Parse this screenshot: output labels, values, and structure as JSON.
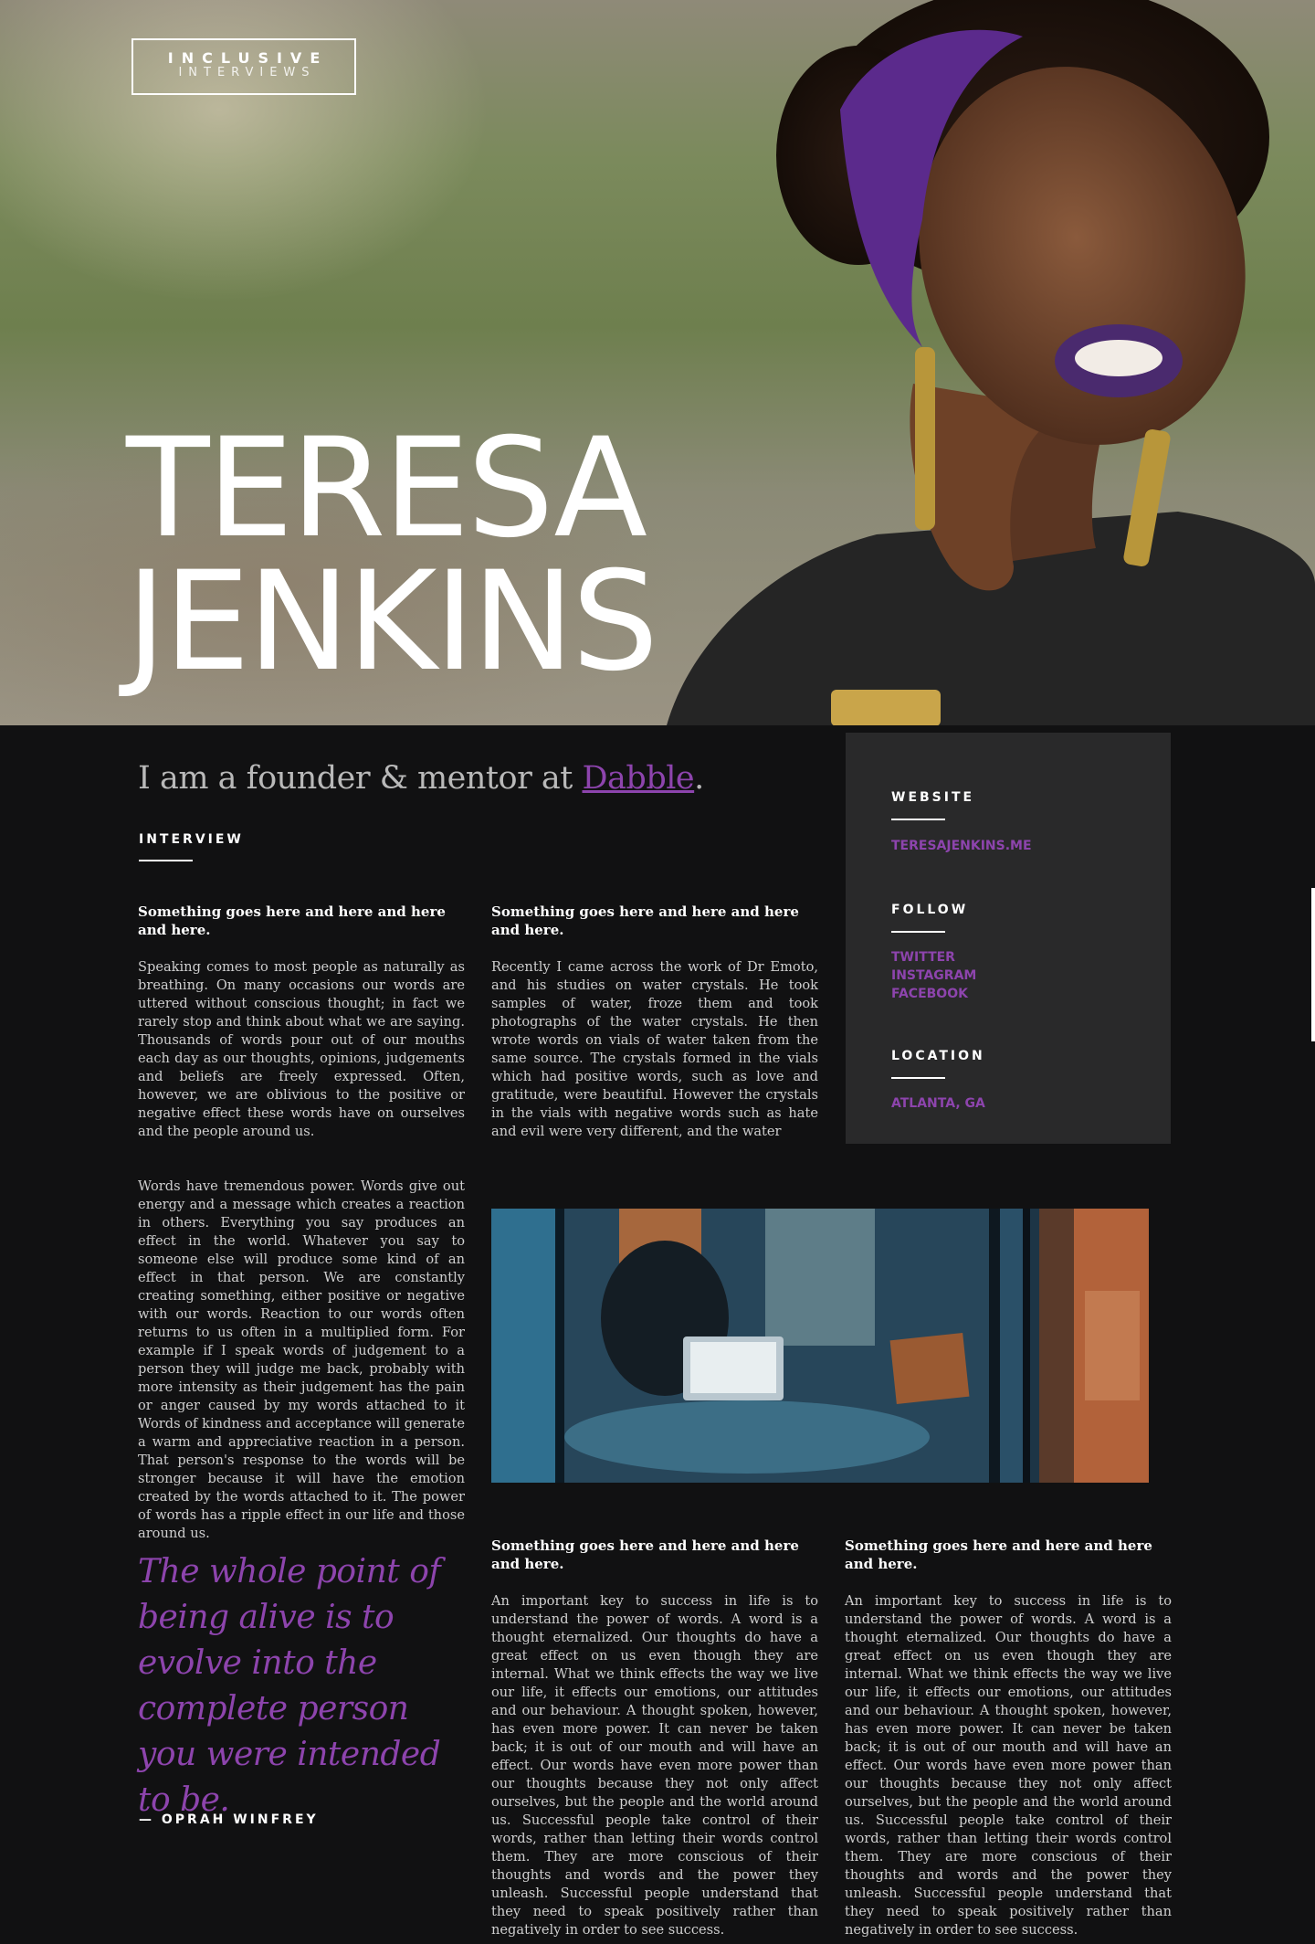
{
  "brand": {
    "line1": "INCLUSIVE",
    "line2": "INTERVIEWS"
  },
  "hero": {
    "first_name": "TERESA",
    "last_name": "JENKINS"
  },
  "intro": {
    "prefix": "I am a founder & mentor at ",
    "link": "Dabble",
    "suffix": "."
  },
  "interview_label": "INTERVIEW",
  "columns": [
    {
      "title": "Something goes here and here and here and here.",
      "text": "Speaking comes to most people as naturally as breathing. On many occasions our words are uttered without conscious thought; in fact we rarely stop and think about what we are saying. Thousands of words pour out of our mouths each day as our thoughts, opinions, judgements and beliefs are freely expressed. Often, however, we are oblivious to the positive or negative effect these words have on ourselves and the people around us."
    },
    {
      "title": "Something goes here and here and here and here.",
      "text": "Recently I came across the work of Dr Emoto, and his studies on water crystals. He took samples of water, froze them and took photographs of the water crystals. He then wrote words on vials of water taken from the same source. The crystals formed in the vials which had positive words, such as love and gratitude, were beautiful. However the crystals in the vials with negative words such as hate and evil were very different, and the water"
    },
    {
      "title": "",
      "text": "Words have tremendous power. Words give out energy and a message which creates a reaction in others. Everything you say produces an effect in the world. Whatever you say to someone else will produce some kind of an effect in that person. We are constantly creating something, either positive or negative with our words. Reaction to our words often returns to us often in a multiplied form. For example if I speak words of judgement to a person they will judge me back, probably with more intensity as their judgement has the pain or anger caused by my words attached to it Words of kindness and acceptance will generate a warm and appreciative reaction in a person. That person's response to the words will be stronger because it will have the emotion created by the words attached to it. The power of words has a ripple effect in our life and those around us."
    },
    {
      "title": "Something goes here and here and here and here.",
      "text": "An important key to success in life is to understand the power of words. A word is a thought eternalized. Our thoughts do have a great effect on us even though they are internal. What we think effects the way we live our life, it effects our emotions, our attitudes and our behaviour. A thought spoken, however, has even more power. It can never be taken back; it is out of our mouth and will have an effect. Our words have even more power than our thoughts because they not only affect ourselves, but the people and the world around us. Successful people take control of their words, rather than letting their words control them. They are more conscious of their thoughts and words and the power they unleash. Successful people understand that they need to speak positively rather than negatively in order to see success."
    },
    {
      "title": "Something goes here and here and here and here.",
      "text": "An important key to success in life is to understand the power of words. A word is a thought eternalized. Our thoughts do have a great effect on us even though they are internal. What we think effects the way we live our life, it effects our emotions, our attitudes and our behaviour. A thought spoken, however, has even more power. It can never be taken back; it is out of our mouth and will have an effect. Our words have even more power than our thoughts because they not only affect ourselves, but the people and the world around us. Successful people take control of their words, rather than letting their words control them. They are more conscious of their thoughts and words and the power they unleash. Successful people understand that they need to speak positively rather than negatively in order to see success."
    }
  ],
  "sidebar": {
    "website_label": "WEBSITE",
    "website": "TERESAJENKINS.ME",
    "follow_label": "FOLLOW",
    "follow": [
      "TWITTER",
      "INSTAGRAM",
      "FACEBOOK"
    ],
    "location_label": "LOCATION",
    "location": "ATLANTA, GA"
  },
  "quote": {
    "text": "The whole point of being alive is to evolve into the complete person you were intended to be.",
    "author": "— OPRAH WINFREY"
  },
  "colors": {
    "accent": "#8d44ad",
    "background": "#111112",
    "sidebar": "#29292a"
  }
}
